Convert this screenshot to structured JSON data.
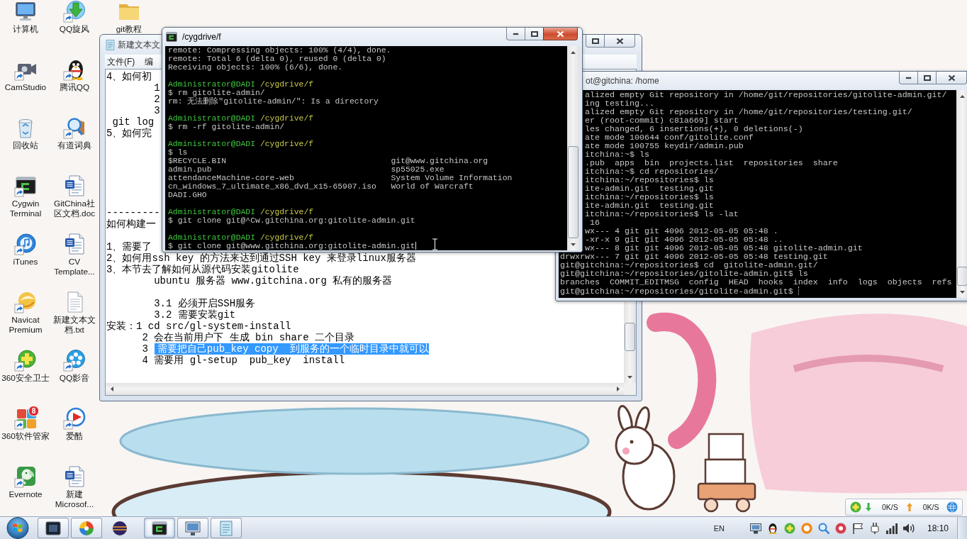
{
  "desktop": {
    "icons": [
      {
        "label": "计算机"
      },
      {
        "label": "CamStudio"
      },
      {
        "label": "回收站"
      },
      {
        "label": "Cygwin Terminal"
      },
      {
        "label": "iTunes"
      },
      {
        "label": "Navicat Premium"
      },
      {
        "label": "360安全卫士"
      },
      {
        "label": "360软件管家",
        "badge": "8"
      },
      {
        "label": "Evernote"
      },
      {
        "label": "QQ旋风"
      },
      {
        "label": "腾讯QQ"
      },
      {
        "label": "有道词典"
      },
      {
        "label": "GitChina社区文档.doc"
      },
      {
        "label": "CV Template..."
      },
      {
        "label": "新建文本文档.txt"
      },
      {
        "label": "QQ影音"
      },
      {
        "label": "爱酷"
      },
      {
        "label": "新建 Microsof..."
      },
      {
        "label": "git教程"
      }
    ]
  },
  "notepad": {
    "title": "新建文本文",
    "active": false,
    "menu": [
      "文件(F)",
      "编"
    ],
    "sections": [
      {
        "lines": [
          {
            "text": "4、如何初"
          },
          {
            "text": "        1"
          },
          {
            "text": "        2"
          },
          {
            "text": "        3"
          },
          {
            "text": " git log"
          },
          {
            "text": "5、如何完"
          }
        ]
      },
      {
        "lines": [
          {
            "text": "---------"
          },
          {
            "text": "如何构建一"
          }
        ]
      },
      {
        "lines": [
          {
            "text": "1、需要了"
          },
          {
            "text": "2、如何用ssh key 的方法来达到通过SSH key 来登录linux服务器"
          },
          {
            "text": "3、本节去了解如何从源代码安装gitolite"
          },
          {
            "text": "        ubuntu 服务器 www.gitchina.org 私有的服务器"
          }
        ]
      },
      {
        "lines": [
          {
            "text": "        3.1 必须开启SSH服务"
          },
          {
            "text": "        3.2 需要安装git"
          },
          {
            "text": "安装：1 cd src/gl-system-install"
          },
          {
            "text": "      2 会在当前用户下 生成 bin share 二个目录"
          },
          {
            "text": "      3",
            "selection": "需要把自己pub_key copy  到服务的一个临时目录中就可以"
          },
          {
            "text": "      4 需要用 gl-setup  pub_key  install"
          }
        ]
      }
    ]
  },
  "cygwin_terminal": {
    "title": "/cygdrive/f",
    "active": true,
    "cursor": true,
    "blocks": [
      {
        "lines": [
          {
            "kind": "text",
            "text": "remote: Compressing objects: 100% (4/4), done."
          },
          {
            "kind": "text",
            "text": "remote: Total 6 (delta 0), reused 0 (delta 0)"
          },
          {
            "kind": "text",
            "text": "Receiving objects: 100% (6/6), done."
          }
        ]
      },
      {
        "prompt": {
          "user": "Administrator@DADI",
          "path": "/cygdrive/f"
        },
        "lines": [
          {
            "kind": "text",
            "text": "$ rm gitolite-admin/"
          },
          {
            "kind": "text",
            "text": "rm: 无法删除\"gitolite-admin/\": Is a directory"
          }
        ]
      },
      {
        "prompt": {
          "user": "Administrator@DADI",
          "path": "/cygdrive/f"
        },
        "lines": [
          {
            "kind": "text",
            "text": "$ rm -rf gitolite-admin/"
          }
        ]
      },
      {
        "prompt": {
          "user": "Administrator@DADI",
          "path": "/cygdrive/f"
        },
        "lines": [
          {
            "kind": "text",
            "text": "$ ls"
          },
          {
            "kind": "columns",
            "cells": [
              "$RECYCLE.BIN",
              "git@www.gitchina.org"
            ]
          },
          {
            "kind": "columns",
            "cells": [
              "admin.pub",
              "sp55025.exe"
            ]
          },
          {
            "kind": "columns",
            "cells": [
              "attendanceMachine-core-web",
              "System Volume Information"
            ]
          },
          {
            "kind": "columns",
            "cells": [
              "cn_windows_7_ultimate_x86_dvd_x15-65907.iso",
              "World of Warcraft"
            ]
          },
          {
            "kind": "text",
            "text": "DADI.GHO"
          }
        ]
      },
      {
        "prompt": {
          "user": "Administrator@DADI",
          "path": "/cygdrive/f"
        },
        "lines": [
          {
            "kind": "text",
            "text": "$ git clone git@^Cw.gitchina.org:gitolite-admin.git"
          }
        ]
      },
      {
        "prompt": {
          "user": "Administrator@DADI",
          "path": "/cygdrive/f"
        },
        "lines": [
          {
            "kind": "text",
            "text": "$ git clone git@www.gitchina.org:gitolite-admin.git"
          }
        ]
      }
    ]
  },
  "ssh_terminal": {
    "title": "ot@gitchina: /home",
    "active": false,
    "cursor": true,
    "lines": [
      {
        "kind": "cut",
        "text": "alized empty Git repository in /home/git/repositories/gitolite-admin.git/"
      },
      {
        "kind": "cut",
        "text": "ing testing..."
      },
      {
        "kind": "cut",
        "text": "alized empty Git repository in /home/git/repositories/testing.git/"
      },
      {
        "kind": "cut",
        "text": "er (root-commit) c81a669] start"
      },
      {
        "kind": "cut",
        "text": "les changed, 6 insertions(+), 0 deletions(-)"
      },
      {
        "kind": "cut",
        "text": "ate mode 100644 conf/gitolite.conf"
      },
      {
        "kind": "cut",
        "text": "ate mode 100755 keydir/admin.pub"
      },
      {
        "kind": "cut",
        "text": "itchina:~$ ls"
      },
      {
        "kind": "cut",
        "text": ".pub  apps  bin  projects.list  repositories  share"
      },
      {
        "kind": "cut",
        "text": "itchina:~$ cd repositories/"
      },
      {
        "kind": "cut",
        "text": "itchina:~/repositories$ ls"
      },
      {
        "kind": "cut",
        "text": "ite-admin.git  testing.git"
      },
      {
        "kind": "cut",
        "text": "itchina:~/repositories$ ls"
      },
      {
        "kind": "cut",
        "text": "ite-admin.git  testing.git"
      },
      {
        "kind": "cut",
        "text": "itchina:~/repositories$ ls -lat"
      },
      {
        "kind": "cut",
        "text": " 16"
      },
      {
        "kind": "cut",
        "text": "wx--- 4 git git 4096 2012-05-05 05:48 ."
      },
      {
        "kind": "cut",
        "text": "-xr-x 9 git git 4096 2012-05-05 05:48 .."
      },
      {
        "kind": "cut",
        "text": "wx--- 8 git git 4096 2012-05-05 05:48 gitolite-admin.git"
      },
      {
        "kind": "full",
        "text": "drwxrwx--- 7 git git 4096 2012-05-05 05:48 testing.git"
      },
      {
        "kind": "full",
        "text": "git@gitchina:~/repositories$ cd  gitolite-admin.git/"
      },
      {
        "kind": "full",
        "text": "git@gitchina:~/repositories/gitolite-admin.git$ ls"
      },
      {
        "kind": "full",
        "text": "branches  COMMIT_EDITMSG  config  HEAD  hooks  index  info  logs  objects  refs"
      },
      {
        "kind": "full",
        "text": "git@gitchina:~/repositories/gitolite-admin.git$"
      }
    ]
  },
  "network_speed": {
    "down": "0K/S",
    "up": "0K/S"
  },
  "taskbar": {
    "tasks": [
      {
        "running": true,
        "selected": false
      },
      {
        "running": true,
        "selected": false
      },
      {
        "running": false,
        "selected": false
      },
      {
        "running": true,
        "selected": true
      },
      {
        "running": true,
        "selected": false
      },
      {
        "running": true,
        "selected": false
      }
    ],
    "language": "EN",
    "clock": "18:10"
  }
}
